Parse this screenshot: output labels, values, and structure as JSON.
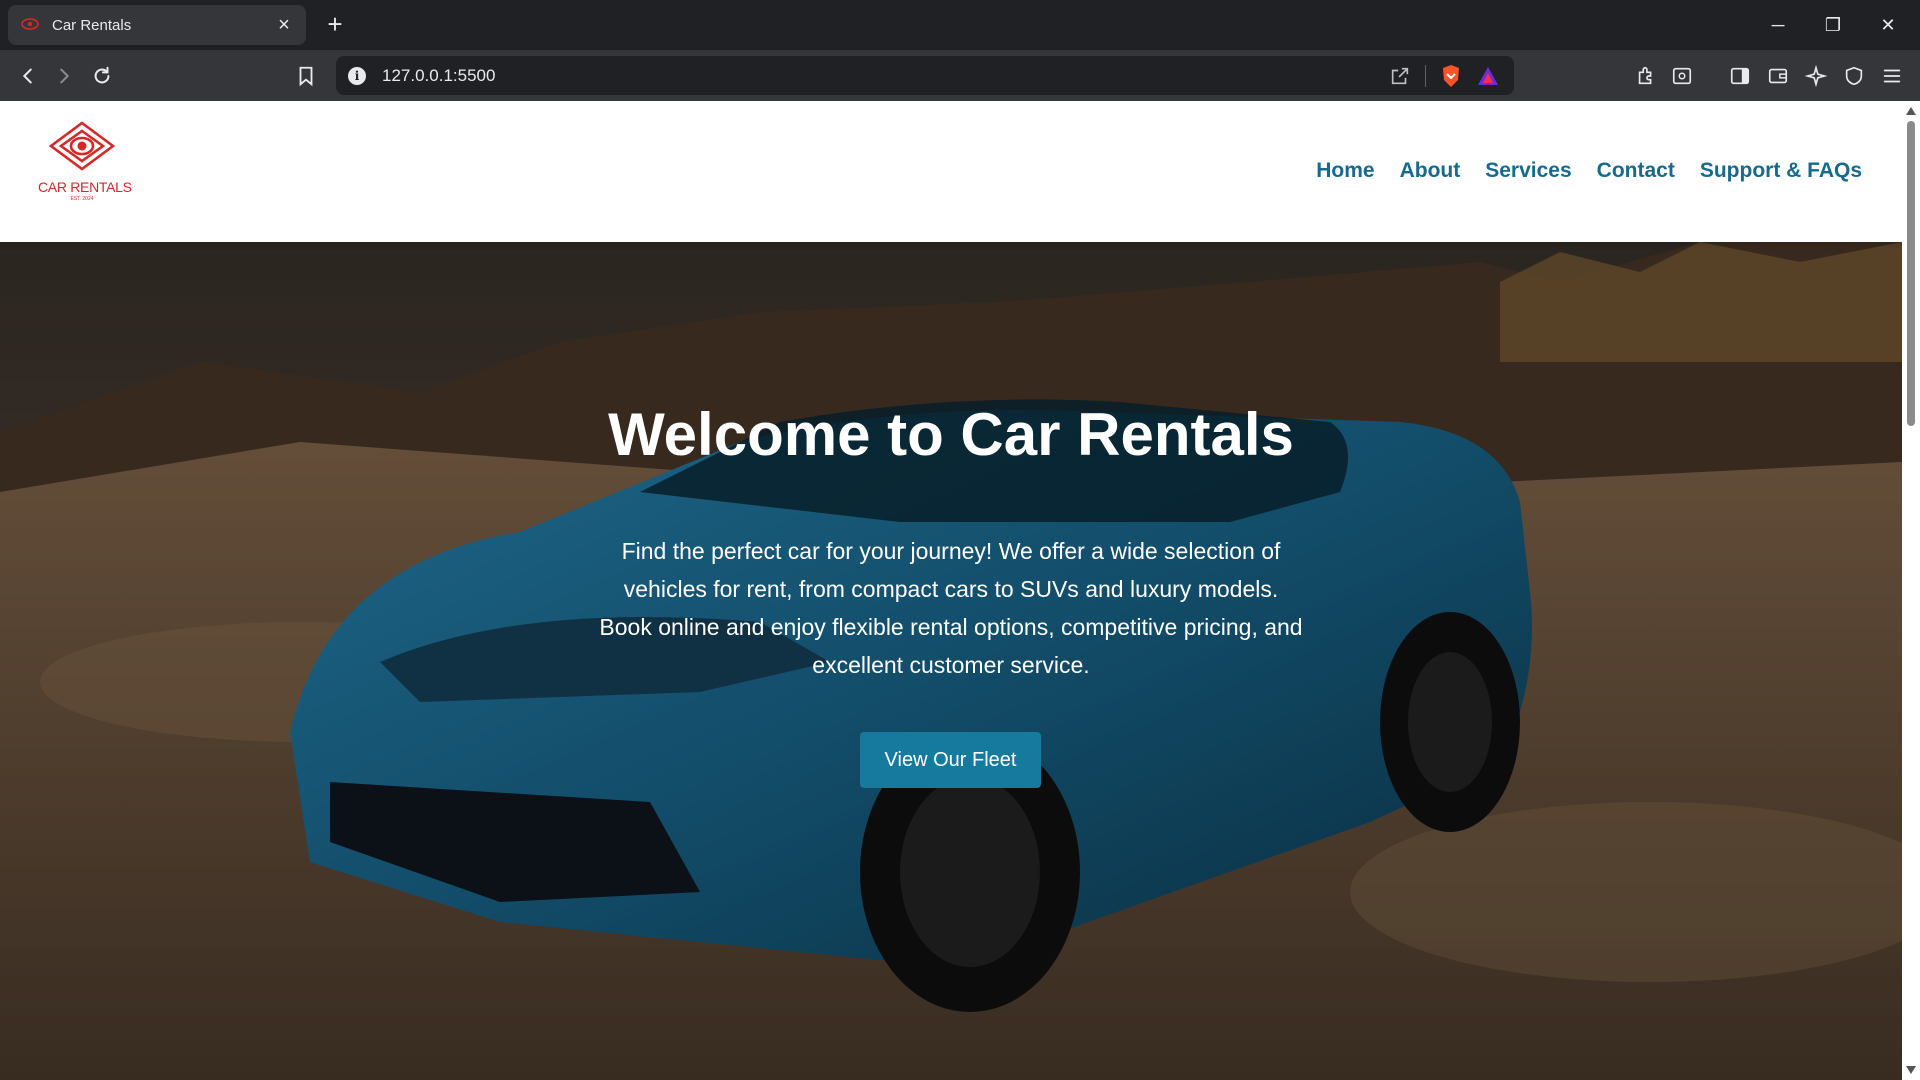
{
  "browser": {
    "tab_title": "Car Rentals",
    "tab_close": "×",
    "new_tab": "+",
    "url": "127.0.0.1:5500",
    "window_controls": {
      "minimize": "─",
      "restore": "❐",
      "close": "✕"
    }
  },
  "site": {
    "logo_name": "CAR RENTALS",
    "logo_est": "EST. 2024",
    "nav": [
      "Home",
      "About",
      "Services",
      "Contact",
      "Support & FAQs"
    ]
  },
  "hero": {
    "title": "Welcome to Car Rentals",
    "text": "Find the perfect car for your journey! We offer a wide selection of vehicles for rent, from compact cars to SUVs and luxury models. Book online and enjoy flexible rental options, competitive pricing, and excellent customer service.",
    "button_label": "View Our Fleet"
  },
  "colors": {
    "brand_red": "#d62828",
    "nav_blue": "#156a8e",
    "button_blue": "#157a9e",
    "car_blue": "#1b6f96"
  }
}
